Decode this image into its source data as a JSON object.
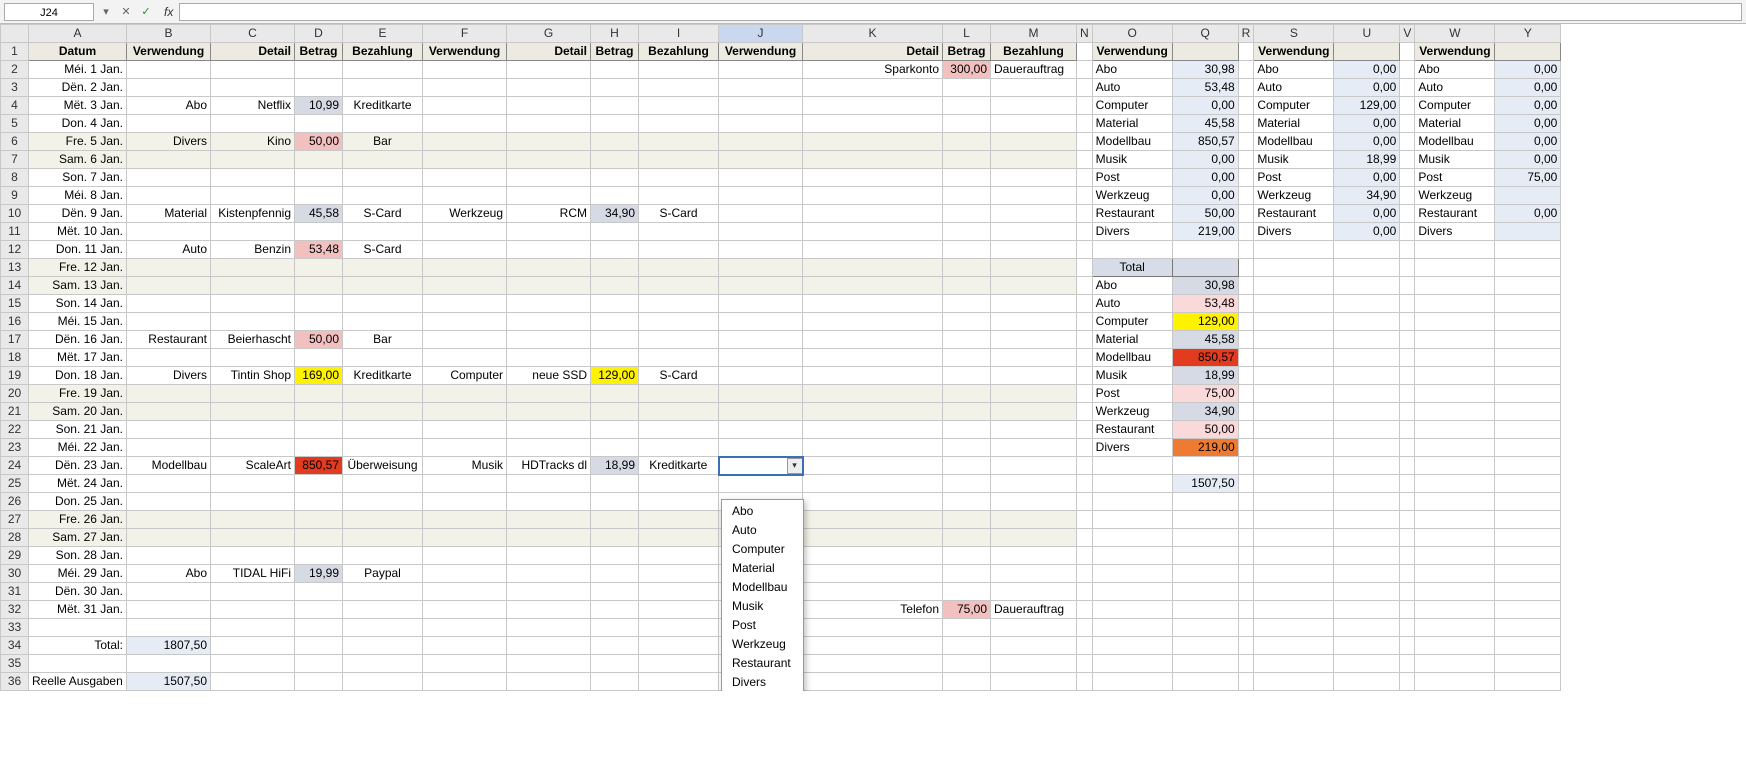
{
  "formula_bar": {
    "name_box": "J24",
    "fx_label": "fx",
    "formula": ""
  },
  "columns": [
    "A",
    "B",
    "C",
    "D",
    "E",
    "F",
    "G",
    "H",
    "I",
    "J",
    "K",
    "L",
    "M",
    "N",
    "O",
    "Q",
    "R",
    "S",
    "U",
    "V",
    "W",
    "Y"
  ],
  "headers": {
    "datum": "Datum",
    "verwendung": "Verwendung",
    "detail": "Detail",
    "betrag": "Betrag",
    "bezahlung": "Bezahlung"
  },
  "dates": [
    "Méi. 1 Jan.",
    "Dën. 2 Jan.",
    "Mët. 3 Jan.",
    "Don. 4 Jan.",
    "Fre. 5 Jan.",
    "Sam. 6 Jan.",
    "Son. 7 Jan.",
    "Méi. 8 Jan.",
    "Dën. 9 Jan.",
    "Mët. 10 Jan.",
    "Don. 11 Jan.",
    "Fre. 12 Jan.",
    "Sam. 13 Jan.",
    "Son. 14 Jan.",
    "Méi. 15 Jan.",
    "Dën. 16 Jan.",
    "Mët. 17 Jan.",
    "Don. 18 Jan.",
    "Fre. 19 Jan.",
    "Sam. 20 Jan.",
    "Son. 21 Jan.",
    "Méi. 22 Jan.",
    "Dën. 23 Jan.",
    "Mët. 24 Jan.",
    "Don. 25 Jan.",
    "Fre. 26 Jan.",
    "Sam. 27 Jan.",
    "Son. 28 Jan.",
    "Méi. 29 Jan.",
    "Dën. 30 Jan.",
    "Mët. 31 Jan."
  ],
  "shaded_rows": [
    6,
    7,
    13,
    14,
    20,
    21,
    27,
    28
  ],
  "main_entries": {
    "2": {
      "M_detail": "Sparkonto",
      "M_betrag": "300,00",
      "M_betrag_cls": "amt-pink",
      "M_bez": "Dauerauftrag"
    },
    "4": {
      "B": "Abo",
      "C": "Netflix",
      "D": "10,99",
      "D_cls": "amt-grey",
      "E": "Kreditkarte"
    },
    "6": {
      "B": "Divers",
      "C": "Kino",
      "D": "50,00",
      "D_cls": "amt-pink",
      "E": "Bar"
    },
    "10": {
      "B": "Material",
      "C": "Kistenpfennig",
      "D": "45,58",
      "D_cls": "amt-grey",
      "E": "S-Card",
      "F": "Werkzeug",
      "G": "RCM",
      "H": "34,90",
      "H_cls": "amt-grey",
      "I": "S-Card"
    },
    "12": {
      "B": "Auto",
      "C": "Benzin",
      "D": "53,48",
      "D_cls": "amt-pink",
      "E": "S-Card"
    },
    "17": {
      "B": "Restaurant",
      "C": "Beierhascht",
      "D": "50,00",
      "D_cls": "amt-pink",
      "E": "Bar"
    },
    "19": {
      "B": "Divers",
      "C": "Tintin Shop",
      "D": "169,00",
      "D_cls": "amt-yellow",
      "E": "Kreditkarte",
      "F": "Computer",
      "G": "neue SSD",
      "H": "129,00",
      "H_cls": "amt-yellow",
      "I": "S-Card"
    },
    "24": {
      "B": "Modellbau",
      "C": "ScaleArt",
      "D": "850,57",
      "D_cls": "amt-red",
      "E": "Überweisung",
      "F": "Musik",
      "G": "HDTracks dl",
      "H": "18,99",
      "H_cls": "amt-grey",
      "I": "Kreditkarte"
    },
    "30": {
      "B": "Abo",
      "C": "TIDAL HiFi",
      "D": "19,99",
      "D_cls": "amt-grey",
      "E": "Paypal"
    },
    "32": {
      "M_detail": "Telefon",
      "M_betrag": "75,00",
      "M_betrag_cls": "amt-pink",
      "M_bez": "Dauerauftrag"
    }
  },
  "totals": {
    "total_label": "Total:",
    "total_val": "1807,50",
    "reelle_label": "Reelle Ausgaben",
    "reelle_val": "1507,50"
  },
  "summary_O": [
    {
      "k": "Abo",
      "v": "30,98"
    },
    {
      "k": "Auto",
      "v": "53,48"
    },
    {
      "k": "Computer",
      "v": "0,00"
    },
    {
      "k": "Material",
      "v": "45,58"
    },
    {
      "k": "Modellbau",
      "v": "850,57"
    },
    {
      "k": "Musik",
      "v": "0,00"
    },
    {
      "k": "Post",
      "v": "0,00"
    },
    {
      "k": "Werkzeug",
      "v": "0,00"
    },
    {
      "k": "Restaurant",
      "v": "50,00"
    },
    {
      "k": "Divers",
      "v": "219,00"
    }
  ],
  "summary_S": [
    {
      "k": "Abo",
      "v": "0,00"
    },
    {
      "k": "Auto",
      "v": "0,00"
    },
    {
      "k": "Computer",
      "v": "129,00"
    },
    {
      "k": "Material",
      "v": "0,00"
    },
    {
      "k": "Modellbau",
      "v": "0,00"
    },
    {
      "k": "Musik",
      "v": "18,99"
    },
    {
      "k": "Post",
      "v": "0,00"
    },
    {
      "k": "Werkzeug",
      "v": "34,90"
    },
    {
      "k": "Restaurant",
      "v": "0,00"
    },
    {
      "k": "Divers",
      "v": "0,00"
    }
  ],
  "summary_W": [
    {
      "k": "Abo",
      "v": "0,00"
    },
    {
      "k": "Auto",
      "v": "0,00"
    },
    {
      "k": "Computer",
      "v": "0,00"
    },
    {
      "k": "Material",
      "v": "0,00"
    },
    {
      "k": "Modellbau",
      "v": "0,00"
    },
    {
      "k": "Musik",
      "v": "0,00"
    },
    {
      "k": "Post",
      "v": "75,00"
    },
    {
      "k": "Werkzeug",
      "v": ""
    },
    {
      "k": "Restaurant",
      "v": "0,00"
    },
    {
      "k": "Divers",
      "v": ""
    }
  ],
  "grand_total": {
    "header": "Total",
    "rows": [
      {
        "k": "Abo",
        "v": "30,98",
        "cls": "amt-grey"
      },
      {
        "k": "Auto",
        "v": "53,48",
        "cls": "amt-ltpink"
      },
      {
        "k": "Computer",
        "v": "129,00",
        "cls": "amt-yellow"
      },
      {
        "k": "Material",
        "v": "45,58",
        "cls": "amt-grey"
      },
      {
        "k": "Modellbau",
        "v": "850,57",
        "cls": "amt-red"
      },
      {
        "k": "Musik",
        "v": "18,99",
        "cls": "amt-grey"
      },
      {
        "k": "Post",
        "v": "75,00",
        "cls": "amt-ltpink"
      },
      {
        "k": "Werkzeug",
        "v": "34,90",
        "cls": "amt-grey"
      },
      {
        "k": "Restaurant",
        "v": "50,00",
        "cls": "amt-ltpink"
      },
      {
        "k": "Divers",
        "v": "219,00",
        "cls": "amt-orange"
      }
    ],
    "sum": "1507,50"
  },
  "dropdown": {
    "items": [
      "Abo",
      "Auto",
      "Computer",
      "Material",
      "Modellbau",
      "Musik",
      "Post",
      "Werkzeug",
      "Restaurant",
      "Divers"
    ]
  },
  "col_widths": {
    "A": 98,
    "B": 84,
    "C": 84,
    "D": 48,
    "E": 80,
    "F": 84,
    "G": 84,
    "H": 48,
    "I": 80,
    "J": 84,
    "K": 140,
    "L": 48,
    "M": 86,
    "N": 14,
    "O": 80,
    "Q": 66,
    "R": 14,
    "S": 80,
    "U": 66,
    "V": 14,
    "W": 80,
    "Y": 66
  }
}
